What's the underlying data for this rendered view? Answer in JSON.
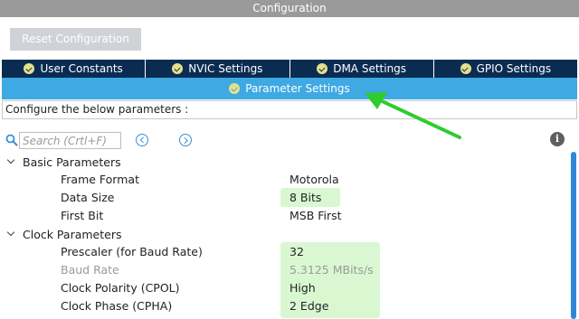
{
  "window": {
    "title": "Configuration"
  },
  "toolbar": {
    "reset_label": "Reset Configuration"
  },
  "tabs": [
    {
      "label": "User Constants"
    },
    {
      "label": "NVIC Settings"
    },
    {
      "label": "DMA Settings"
    },
    {
      "label": "GPIO Settings"
    }
  ],
  "active_tab": {
    "label": "Parameter Settings"
  },
  "instructions": "Configure the below parameters :",
  "search": {
    "placeholder": "Search (Crtl+F)"
  },
  "groups": [
    {
      "label": "Basic Parameters",
      "params": [
        {
          "name": "Frame Format",
          "value": "Motorola"
        },
        {
          "name": "Data Size",
          "value": "8 Bits"
        },
        {
          "name": "First Bit",
          "value": "MSB First"
        }
      ]
    },
    {
      "label": "Clock Parameters",
      "params": [
        {
          "name": "Prescaler (for Baud Rate)",
          "value": "32"
        },
        {
          "name": "Baud Rate",
          "value": "5.3125 MBits/s"
        },
        {
          "name": "Clock Polarity (CPOL)",
          "value": "High"
        },
        {
          "name": "Clock Phase (CPHA)",
          "value": "2 Edge"
        }
      ]
    }
  ],
  "colors": {
    "titlebar": "#9a9a9a",
    "tab_bar": "#0b2c52",
    "active_tab": "#3ea9e2",
    "highlight": "#d9f8d2",
    "annotation_arrow": "#2ecc2e"
  }
}
